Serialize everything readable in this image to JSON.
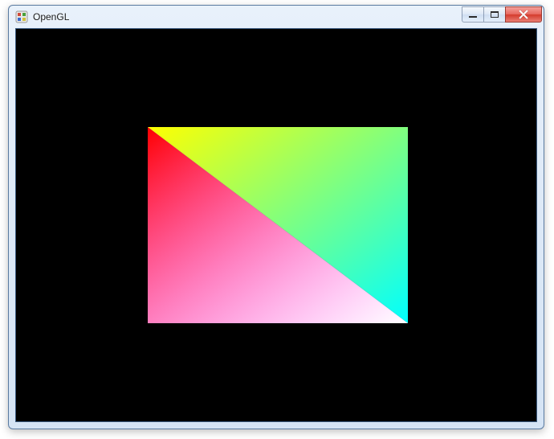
{
  "window": {
    "title": "OpenGL",
    "icon_name": "opengl-app-icon"
  },
  "caption_buttons": {
    "minimize": {
      "name": "minimize-button"
    },
    "maximize": {
      "name": "maximize-button"
    },
    "close": {
      "name": "close-button"
    }
  },
  "render": {
    "background_color": "#000000",
    "quad": {
      "top_left_color": "#ff0000",
      "top_right_color": "#00ff00",
      "bottom_right_color": "#0000ff",
      "bottom_left_color": "#ffffff"
    }
  }
}
